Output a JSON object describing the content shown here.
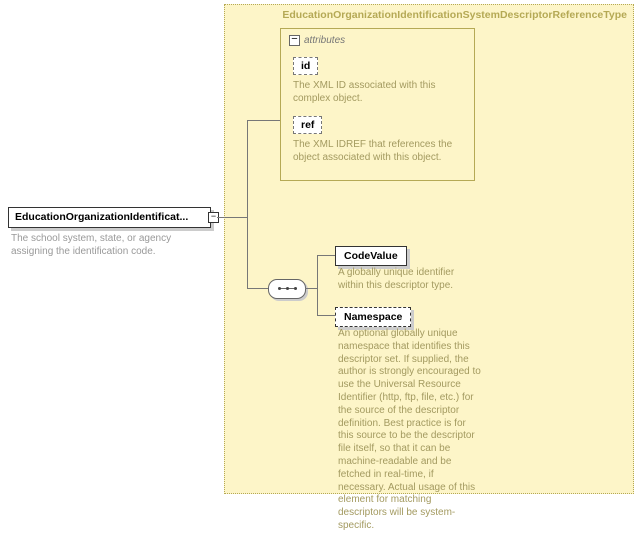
{
  "root": {
    "label": "EducationOrganizationIdentificat...",
    "description": "The school system, state, or agency assigning the identification code."
  },
  "type": {
    "title": "EducationOrganizationIdentificationSystemDescriptorReferenceType",
    "attributes_label": "attributes",
    "attributes": [
      {
        "name": "id",
        "description": "The XML ID associated with this complex object."
      },
      {
        "name": "ref",
        "description": "The XML IDREF that references the object associated with this object."
      }
    ],
    "elements": [
      {
        "name": "CodeValue",
        "description": "A globally unique identifier within this descriptor type."
      },
      {
        "name": "Namespace",
        "description": "An optional globally unique namespace that identifies this descriptor set. If supplied, the author is strongly encouraged to use the Universal Resource Identifier (http, ftp, file, etc.) for the source of the descriptor definition. Best practice is for this source to be the descriptor file itself, so that it can be machine-readable and be fetched in real-time, if necessary. Actual usage of this element for matching descriptors will be system-specific."
      }
    ]
  }
}
